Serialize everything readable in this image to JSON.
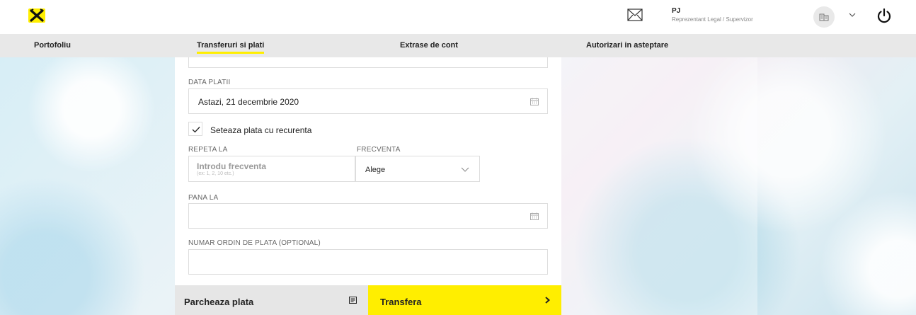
{
  "header": {
    "user_name": "PJ",
    "user_role": "Reprezentant Legal / Supervizor",
    "icons": [
      "raiffeisen-logo-icon",
      "mail-icon",
      "company-icon",
      "chevron-down-icon",
      "power-icon"
    ]
  },
  "nav": {
    "items": [
      {
        "label": "Portofoliu"
      },
      {
        "label": "Transferuri si plati",
        "active": true
      },
      {
        "label": "Extrase de cont"
      },
      {
        "label": "Autorizari in asteptare"
      }
    ]
  },
  "form": {
    "date_label": "DATA PLATII",
    "date_value": "Astazi, 21 decembrie 2020",
    "recurrence_checked": true,
    "recurrence_label": "Seteaza plata cu recurenta",
    "repeat_label": "REPETA LA",
    "repeat_placeholder": "Introdu frecventa",
    "repeat_hint": "(ex: 1, 2, 10 etc.)",
    "frequency_label": "FRECVENTA",
    "frequency_value": "Alege",
    "until_label": "PANA LA",
    "until_value": "",
    "order_label": "NUMAR ORDIN DE PLATA (OPTIONAL)",
    "order_value": ""
  },
  "actions": {
    "park_label": "Parcheaza plata",
    "send_label": "Transfera"
  },
  "colors": {
    "accent": "#ffee00",
    "nav_bg": "#e8e8e8",
    "text": "#222222"
  }
}
